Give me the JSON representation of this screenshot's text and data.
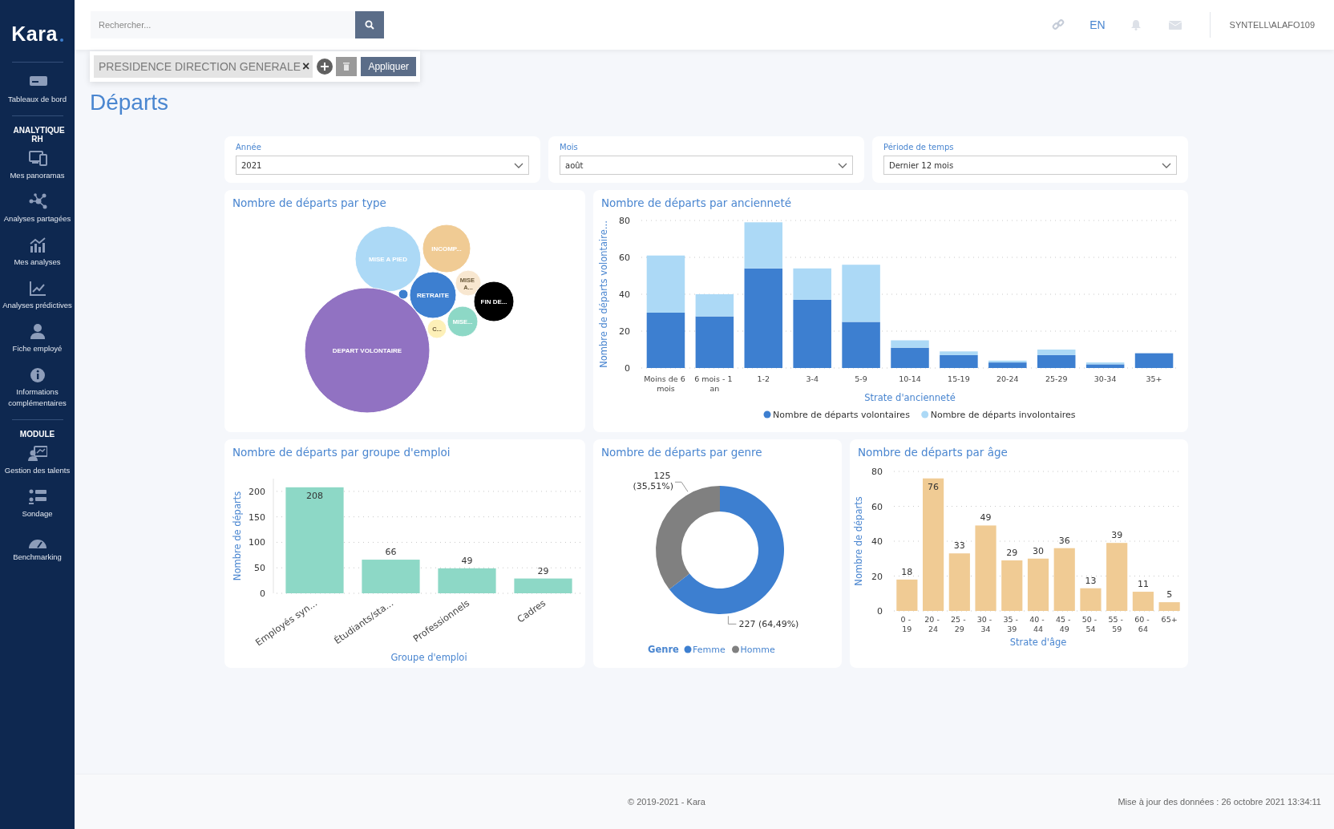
{
  "sidebar": {
    "logo": "Kara",
    "items": [
      {
        "kind": "item",
        "label": "Tableaux de bord"
      },
      {
        "kind": "heading",
        "label": "ANALYTIQUE RH"
      },
      {
        "kind": "item",
        "label": "Mes panoramas"
      },
      {
        "kind": "item",
        "label": "Analyses partagées"
      },
      {
        "kind": "item",
        "label": "Mes analyses"
      },
      {
        "kind": "item",
        "label": "Analyses prédictives"
      },
      {
        "kind": "item",
        "label": "Fiche employé"
      },
      {
        "kind": "item",
        "label": "Informations complémentaires"
      },
      {
        "kind": "heading",
        "label": "MODULE"
      },
      {
        "kind": "item",
        "label": "Gestion des talents"
      },
      {
        "kind": "item",
        "label": "Sondage"
      },
      {
        "kind": "item",
        "label": "Benchmarking"
      }
    ]
  },
  "topbar": {
    "search": {
      "placeholder": "Rechercher..."
    },
    "language": "EN",
    "user": "SYNTELL\\ALAFO109"
  },
  "filter_bar": {
    "chip": "PRESIDENCE DIRECTION GENERALE",
    "remove": "×",
    "apply": "Appliquer"
  },
  "page_title": "Départs",
  "filters": [
    {
      "label": "Année",
      "value": "2021"
    },
    {
      "label": "Mois",
      "value": "août"
    },
    {
      "label": "Période de temps",
      "value": "Dernier 12 mois"
    }
  ],
  "charts": [
    {
      "kind": "bubble",
      "title": "Nombre de départs par type",
      "bubbles": [
        {
          "label": "MISE A PIED",
          "color": "#acd9f6"
        },
        {
          "label": "INCOMP...",
          "color": "#f0cb94"
        },
        {
          "label": "MISE A...",
          "color": "#f8e7d0"
        },
        {
          "label": "RETRAITE",
          "color": "#3d7fd0"
        },
        {
          "label": "FIN DE...",
          "color": "#000000"
        },
        {
          "label": "MISE...",
          "color": "#8dd8c6"
        },
        {
          "label": "C...",
          "color": "#fdf0b8"
        },
        {
          "label": "DEPART VOLONTAIRE",
          "color": "#9172c2"
        },
        {
          "color": "#3d7fcf"
        }
      ]
    },
    {
      "kind": "bar",
      "title": "Nombre de départs par ancienneté",
      "chart_data": {
        "type": "bar",
        "xlabel": "Strate d'ancienneté",
        "ylabel": "Nombre de départs volontaire...",
        "categories": [
          "Moins de 6 mois",
          "6 mois - 1 an",
          "1-2",
          "3-4",
          "5-9",
          "10-14",
          "15-19",
          "20-24",
          "25-29",
          "30-34",
          "35+"
        ],
        "stacked": true,
        "grid": true,
        "legend": "bottom",
        "ylim": [
          0,
          80
        ],
        "yticks": [
          0,
          20,
          40,
          60,
          80
        ],
        "series": [
          {
            "name": "Nombre de départs volontaires",
            "color": "#3d7fd0",
            "values": [
              30,
              28,
              54,
              37,
              25,
              11,
              7,
              3,
              7,
              2,
              8
            ]
          },
          {
            "name": "Nombre de départs involontaires",
            "color": "#acd9f6",
            "values": [
              31,
              12,
              25,
              17,
              31,
              4,
              2,
              1,
              3,
              1,
              0
            ]
          }
        ]
      }
    },
    {
      "kind": "bar",
      "title": "Nombre de départs par groupe d'emploi",
      "chart_data": {
        "type": "bar",
        "xlabel": "Groupe d'emploi",
        "ylabel": "Nombre de départs",
        "categories": [
          "Employés syn...",
          "Étudiants/sta...",
          "Professionnels",
          "Cadres"
        ],
        "grid": true,
        "ylim": [
          0,
          225
        ],
        "yticks": [
          0,
          50,
          100,
          150,
          200
        ],
        "data_labels": true,
        "series": [
          {
            "color": "#8dd8c6",
            "values": [
              208,
              66,
              49,
              29
            ]
          }
        ]
      }
    },
    {
      "kind": "donut",
      "title": "Nombre de départs par genre",
      "legend_title": "Genre",
      "chart_data": {
        "type": "donut",
        "categories": [
          "Femme",
          "Homme"
        ],
        "legend": "bottom",
        "series": [
          {
            "values": [
              64.49,
              35.51
            ]
          }
        ],
        "colors": [
          "#3d7fd0",
          "#808080"
        ],
        "value_labels": [
          "227 (64,49%)",
          "125 (35,51%)"
        ]
      }
    },
    {
      "kind": "bar",
      "title": "Nombre de départs par âge",
      "chart_data": {
        "type": "bar",
        "xlabel": "Strate d'âge",
        "ylabel": "Nombre de départs",
        "categories": [
          "0 - 19",
          "20 - 24",
          "25 - 29",
          "30 - 34",
          "35 - 39",
          "40 - 44",
          "45 - 49",
          "50 - 54",
          "55 - 59",
          "60 - 64",
          "65+"
        ],
        "grid": true,
        "ylim": [
          0,
          80
        ],
        "yticks": [
          0,
          20,
          40,
          60,
          80
        ],
        "data_labels": true,
        "series": [
          {
            "color": "#f0cb94",
            "values": [
              18,
              76,
              33,
              49,
              29,
              30,
              36,
              13,
              39,
              11,
              5
            ]
          }
        ]
      }
    }
  ],
  "footer": {
    "copyright": "© 2019-2021 - Kara",
    "updated": "Mise à jour des données : 26 octobre 2021 13:34:11"
  }
}
